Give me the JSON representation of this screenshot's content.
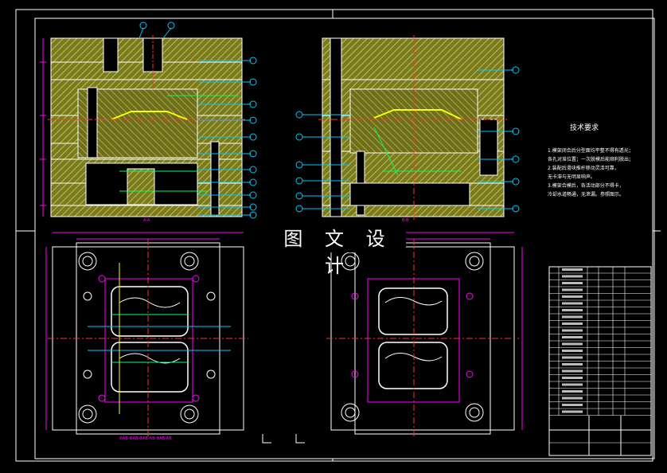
{
  "watermark": "图 文 设 计",
  "tech_requirements": {
    "title": "技术要求",
    "notes": [
      "1.模架闭合后分型面均平整不得有透光；",
      "各孔对准位置；一次脱模后能顺利脱出；",
      "2.装配后滑块推杆移动灵活可靠，",
      "无卡滞与无明显响声。",
      "3.模架合模后，各活动部分不得卡，",
      "冷却水道畅通，无泄漏。参照图示。"
    ]
  },
  "section_labels": [
    "A-A",
    "B-B"
  ],
  "bottom_dimension": "ΦAB-ΦAB-ΦAB-AB-ΦAB-AB",
  "colors": {
    "background": "#000000",
    "frame": "#ffffff",
    "mold_fill": "#8a8a2a",
    "hatch": "#c8c840",
    "outline": "#ffffff",
    "dimension": "#ff00ff",
    "center": "#ff3030",
    "callout": "#00c8ff",
    "water": "#00ff60",
    "label_yellow": "#ffff00"
  }
}
